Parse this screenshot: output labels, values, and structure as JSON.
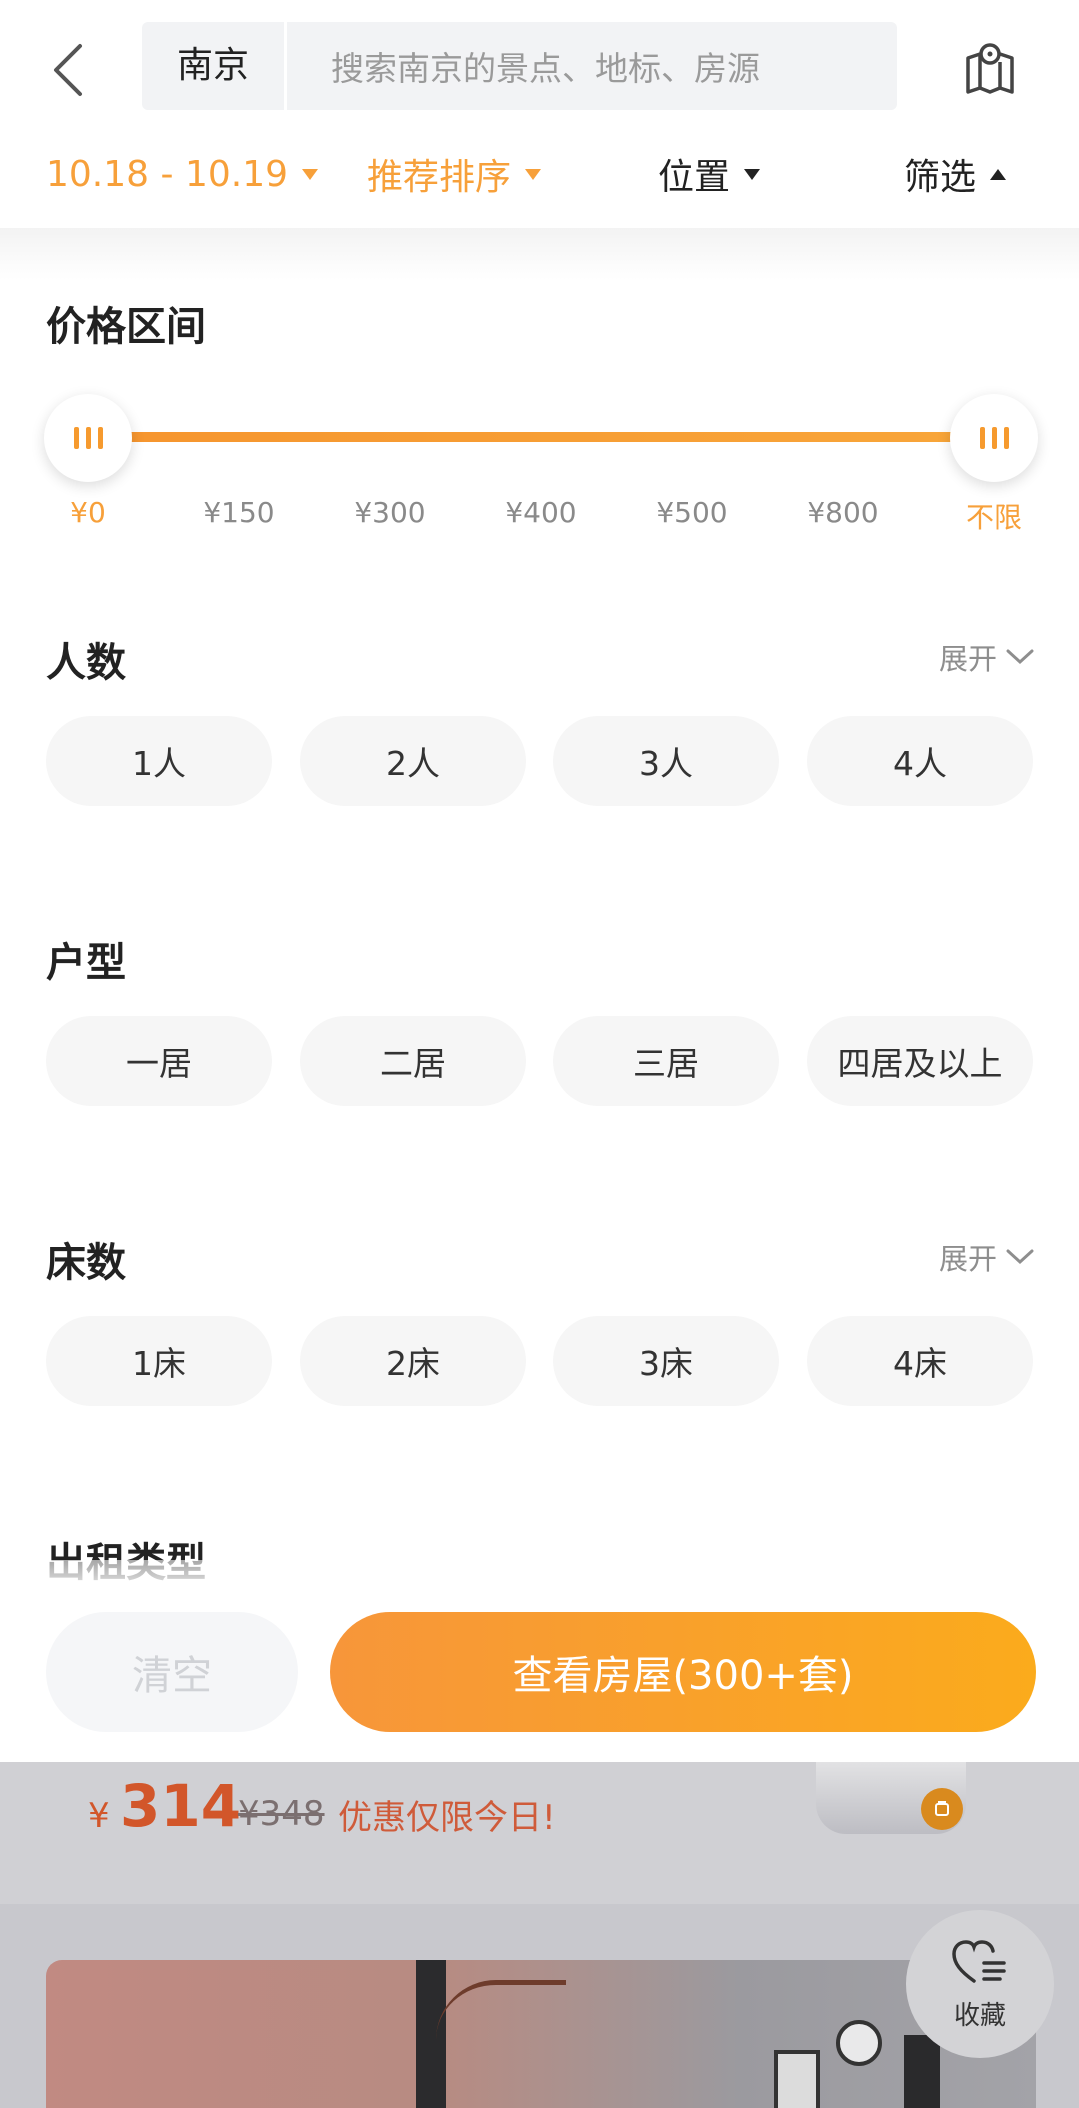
{
  "header": {
    "city": "南京",
    "search_placeholder": "搜索南京的景点、地标、房源"
  },
  "filter_bar": {
    "date": "10.18 - 10.19",
    "sort": "推荐排序",
    "location": "位置",
    "filter": "筛选"
  },
  "price": {
    "title": "价格区间",
    "ticks": [
      "¥0",
      "¥150",
      "¥300",
      "¥400",
      "¥500",
      "¥800",
      "不限"
    ],
    "selected_min": "¥0",
    "selected_max": "不限"
  },
  "guests": {
    "title": "人数",
    "expand": "展开",
    "options": [
      "1人",
      "2人",
      "3人",
      "4人"
    ]
  },
  "layout": {
    "title": "户型",
    "options": [
      "一居",
      "二居",
      "三居",
      "四居及以上"
    ]
  },
  "beds": {
    "title": "床数",
    "expand": "展开",
    "options": [
      "1床",
      "2床",
      "3床",
      "4床"
    ]
  },
  "rental_type": {
    "title": "出租类型"
  },
  "actions": {
    "clear": "清空",
    "view": "查看房屋(300+套)"
  },
  "listing": {
    "currency": "¥",
    "price": "314",
    "original_price": "¥348",
    "promo": "优惠仅限今日!",
    "favorite": "收藏"
  },
  "colors": {
    "accent": "#f7a03a",
    "button_start": "#f7963a",
    "button_end": "#fbab1c"
  }
}
